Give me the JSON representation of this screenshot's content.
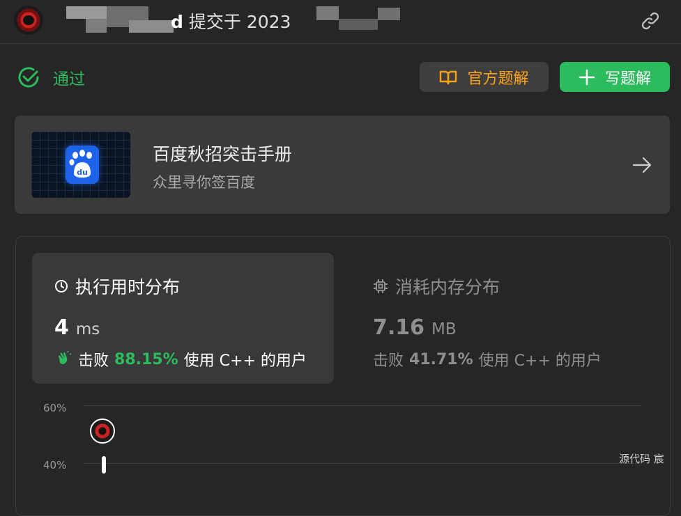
{
  "header": {
    "username_tail": "d",
    "submitted_text": "提交于 2023"
  },
  "status": {
    "label": "通过",
    "color": "#2cbb5d"
  },
  "buttons": {
    "official_solution": "官方题解",
    "write_solution": "写题解"
  },
  "promo": {
    "title": "百度秋招突击手册",
    "subtitle": "众里寻你签百度",
    "logo_text": "du"
  },
  "runtime": {
    "title": "执行用时分布",
    "value": "4",
    "unit": "ms",
    "beat_prefix": "击败",
    "beat_percent": "88.15%",
    "beat_suffix": "使用 C++ 的用户"
  },
  "memory": {
    "title": "消耗内存分布",
    "value": "7.16",
    "unit": "MB",
    "beat_prefix": "击败",
    "beat_percent": "41.71%",
    "beat_suffix": "使用 C++ 的用户"
  },
  "chart": {
    "y_ticks": [
      "60%",
      "40%"
    ]
  },
  "footer": {
    "right_text": "源代码   宸"
  },
  "colors": {
    "accent_green": "#2cbb5d",
    "accent_orange": "#ffa116",
    "background": "#262626"
  }
}
